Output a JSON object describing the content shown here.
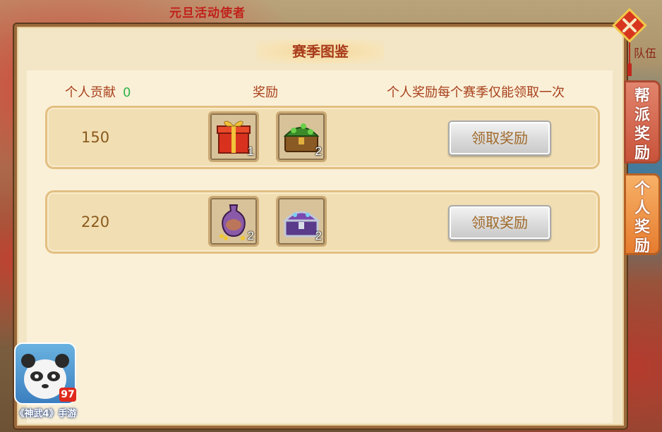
{
  "background": {
    "event_text": "元旦活动使者",
    "team_text": "队伍"
  },
  "dialog": {
    "title": "赛季图鉴",
    "header": {
      "contribution_label": "个人贡献",
      "contribution_value": "0",
      "reward_label": "奖励",
      "note": "个人奖励每个赛季仅能领取一次"
    },
    "rows": [
      {
        "threshold": "150",
        "items": [
          {
            "icon": "gift-box-icon",
            "count": "1"
          },
          {
            "icon": "green-treasure-chest-icon",
            "count": "2"
          }
        ],
        "button_label": "领取奖励"
      },
      {
        "threshold": "220",
        "items": [
          {
            "icon": "vase-icon",
            "count": "2"
          },
          {
            "icon": "purple-treasure-chest-icon",
            "count": "2"
          }
        ],
        "button_label": "领取奖励"
      }
    ]
  },
  "tabs": {
    "guild_reward": "帮派奖励",
    "personal_reward": "个人奖励"
  },
  "logo": {
    "caption": "《神武4》手游",
    "badge": "97"
  },
  "colors": {
    "panel_bg": "#f3e6c6",
    "title_text": "#a83c1c",
    "contribution_value": "#2fb44a",
    "button_text": "#a06a2a",
    "active_tab": "#e67c2f",
    "inactive_tab": "#c8533a"
  }
}
